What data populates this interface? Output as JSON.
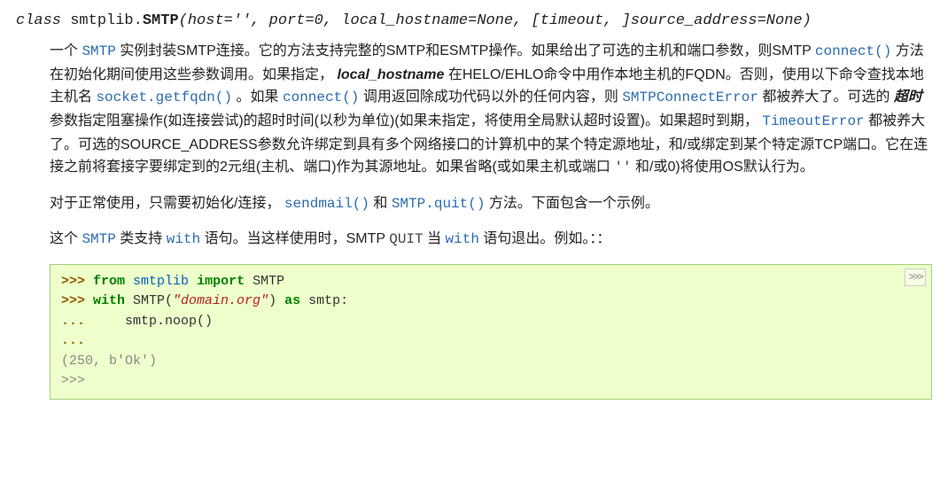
{
  "signature": {
    "kw_class": "class ",
    "module": "smtplib.",
    "name": "SMTP",
    "open": "(",
    "params": "host='', port=0, local_hostname=None, ",
    "bracket_open": "[",
    "params2": "timeout, ",
    "bracket_close": "]",
    "params3": "source_address=None",
    "close": ")"
  },
  "p1": {
    "t1": "一个 ",
    "link_smtp": "SMTP",
    "t2": " 实例封装SMTP连接。它的方法支持完整的SMTP和ESMTP操作。如果给出了可选的主机和端口参数，则SMTP ",
    "link_connect1": "connect()",
    "t3": " 方法在初始化期间使用这些参数调用。如果指定， ",
    "em_localhost": "local_hostname",
    "t4": " 在HELO/EHLO命令中用作本地主机的FQDN。否则，使用以下命令查找本地主机名 ",
    "link_getfqdn": "socket.getfqdn()",
    "t5": " 。如果 ",
    "link_connect2": "connect()",
    "t6": " 调用返回除成功代码以外的任何内容，则 ",
    "link_connerr": "SMTPConnectError",
    "t7": " 都被养大了。可选的 ",
    "em_timeout": "超时",
    "t8": " 参数指定阻塞操作(如连接尝试)的超时时间(以秒为单位)(如果未指定，将使用全局默认超时设置)。如果超时到期， ",
    "link_timeouterr": "TimeoutError",
    "t9": " 都被养大了。可选的SOURCE_ADDRESS参数允许绑定到具有多个网络接口的计算机中的某个特定源地址，和/或绑定到某个特定源TCP端口。它在连接之前将套接字要绑定到的2元组(主机、端口)作为其源地址。如果省略(或如果主机或端口 ",
    "lit_empty": "''",
    "t10": " 和/或0)将使用OS默认行为。"
  },
  "p2": {
    "t1": "对于正常使用，只需要初始化/连接， ",
    "link_sendmail": "sendmail()",
    "t2": " 和 ",
    "link_quit": "SMTP.quit()",
    "t3": " 方法。下面包含一个示例。"
  },
  "p3": {
    "t1": "这个 ",
    "link_smtp": "SMTP",
    "t2": " 类支持 ",
    "link_with1": "with",
    "t3": " 语句。当这样使用时，SMTP ",
    "lit_quit": "QUIT",
    "t4": " 当 ",
    "link_with2": "with",
    "t5": " 语句退出。例如。：："
  },
  "code": {
    "copy": ">>>",
    "l1_prompt": ">>> ",
    "l1_kw1": "from",
    "l1_sp1": " ",
    "l1_mod": "smtplib",
    "l1_sp2": " ",
    "l1_kw2": "import",
    "l1_sp3": " ",
    "l1_name": "SMTP",
    "l2_prompt": ">>> ",
    "l2_kw": "with",
    "l2_t1": " SMTP(",
    "l2_str": "\"domain.org\"",
    "l2_t2": ") ",
    "l2_kw2": "as",
    "l2_t3": " smtp:",
    "l3_prompt": "... ",
    "l3_body": "    smtp.noop()",
    "l4_prompt": "...",
    "l5_out": "(250, b'Ok')",
    "l6_prompt": ">>>"
  }
}
